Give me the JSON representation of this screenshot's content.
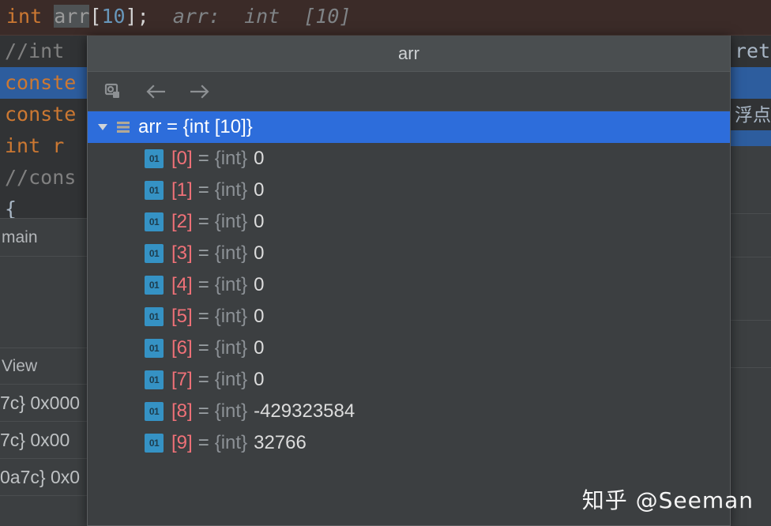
{
  "editor": {
    "error_line": {
      "keyword": "int",
      "identifier": "arr",
      "bracket_open": "[",
      "size": "10",
      "bracket_close": "];",
      "inlay_hint": "arr:  int  [10]"
    },
    "left_lines": [
      {
        "text": "//int",
        "selected": false,
        "comment": true
      },
      {
        "text": "conste",
        "selected": true,
        "comment": false
      },
      {
        "text": "conste",
        "selected": false,
        "comment": false
      },
      {
        "text": "int r",
        "selected": false,
        "comment": false
      },
      {
        "text": "//cons",
        "selected": false,
        "comment": true
      },
      {
        "text": "{",
        "selected": false,
        "comment": false
      }
    ],
    "left_tab_label": "main",
    "left_panel_label": "View",
    "left_hex_rows": [
      "7c} 0x000",
      "7c} 0x00",
      "0a7c} 0x0"
    ],
    "right_lines": [
      {
        "text": "ret",
        "selected": false
      },
      {
        "text": "",
        "selected": true
      },
      {
        "text": "浮点数",
        "selected": false,
        "cjk": true
      }
    ]
  },
  "popup": {
    "title": "arr",
    "toolbar": {
      "items": [
        {
          "name": "evaluate-expression-icon",
          "label": "Evaluate expression"
        },
        {
          "name": "arrow-left-icon",
          "label": "Back"
        },
        {
          "name": "arrow-right-icon",
          "label": "Forward"
        }
      ]
    },
    "tree": {
      "root": {
        "name": "arr",
        "separator": "=",
        "type": "{int [10]}",
        "expanded": true,
        "selected": true,
        "display": "arr = {int [10]}"
      },
      "children": [
        {
          "index": "[0]",
          "eq": "=",
          "type": "{int}",
          "value": "0"
        },
        {
          "index": "[1]",
          "eq": "=",
          "type": "{int}",
          "value": "0"
        },
        {
          "index": "[2]",
          "eq": "=",
          "type": "{int}",
          "value": "0"
        },
        {
          "index": "[3]",
          "eq": "=",
          "type": "{int}",
          "value": "0"
        },
        {
          "index": "[4]",
          "eq": "=",
          "type": "{int}",
          "value": "0"
        },
        {
          "index": "[5]",
          "eq": "=",
          "type": "{int}",
          "value": "0"
        },
        {
          "index": "[6]",
          "eq": "=",
          "type": "{int}",
          "value": "0"
        },
        {
          "index": "[7]",
          "eq": "=",
          "type": "{int}",
          "value": "0"
        },
        {
          "index": "[8]",
          "eq": "=",
          "type": "{int}",
          "value": "-429323584"
        },
        {
          "index": "[9]",
          "eq": "=",
          "type": "{int}",
          "value": "32766"
        }
      ]
    }
  },
  "watermark": {
    "text": "知乎 @Seeman"
  },
  "colors": {
    "selection_blue": "#2d6ddb",
    "editor_selection_blue": "#2d5d9e",
    "error_line_bg": "#3b2b28",
    "panel_bg": "#3c3f41",
    "title_bg": "#4a4e50",
    "index_red": "#f07178",
    "int_icon_blue": "#3592c4",
    "keyword_orange": "#cc7832",
    "number_blue": "#6897bb"
  }
}
